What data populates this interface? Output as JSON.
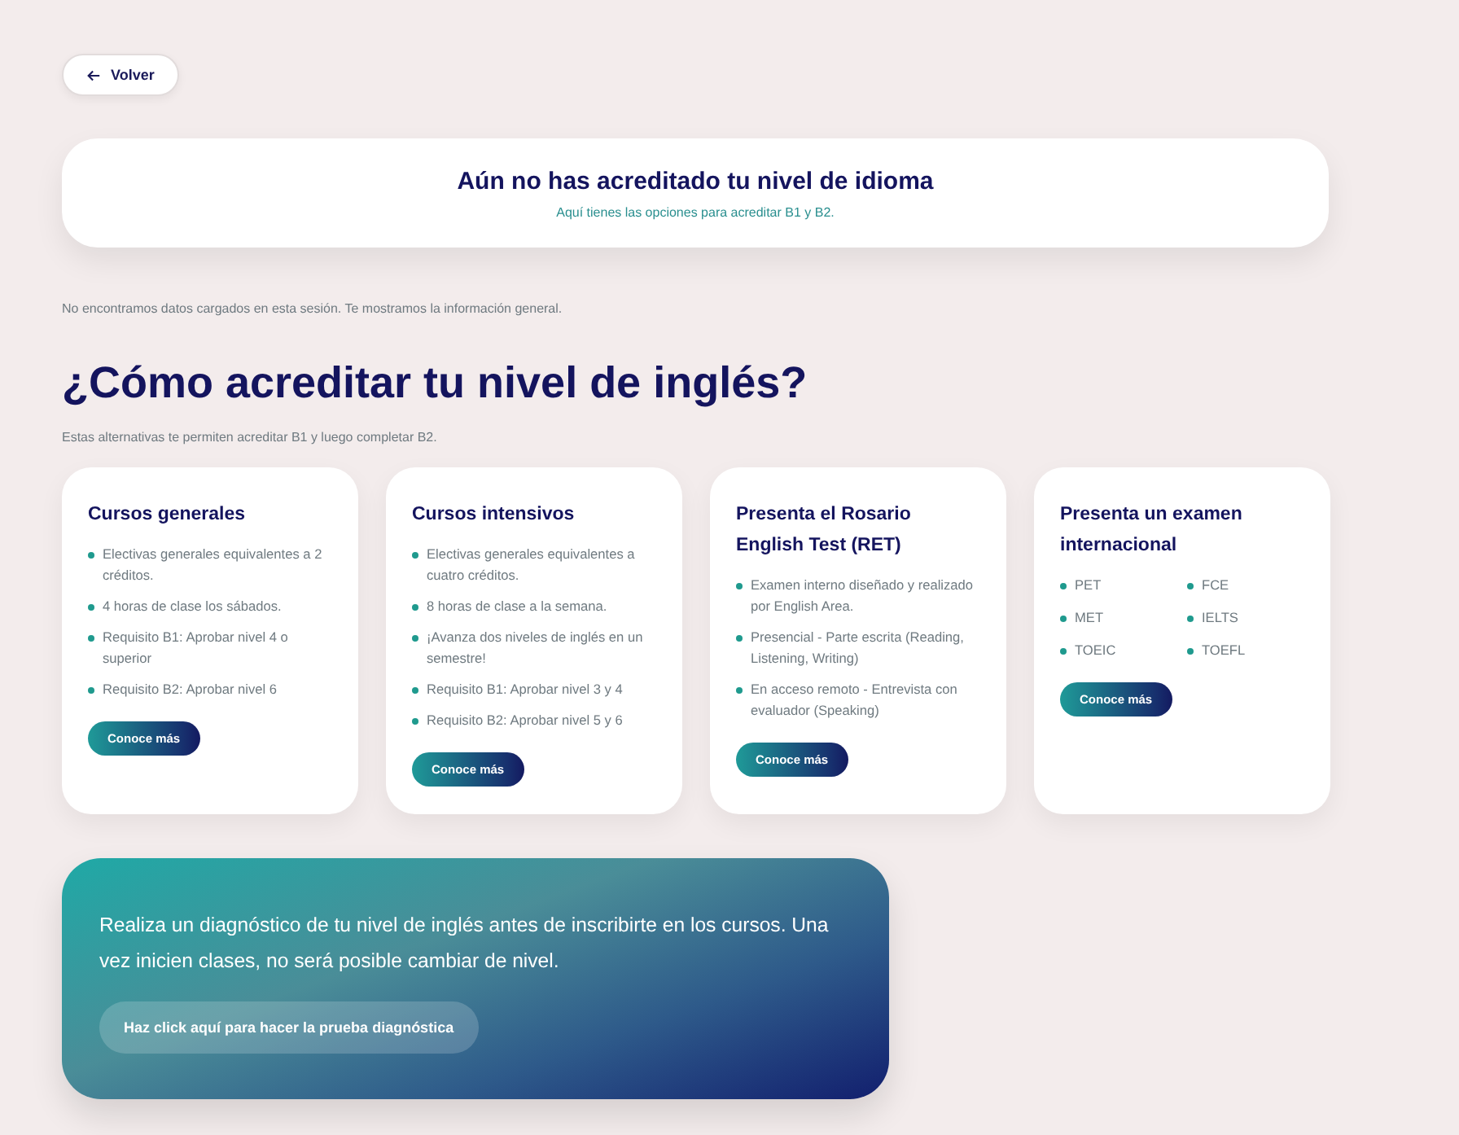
{
  "back_button": {
    "label": "Volver"
  },
  "banner": {
    "title": "Aún no has acreditado tu nivel de idioma",
    "subtitle": "Aquí tienes las opciones para acreditar B1 y B2."
  },
  "notice": "No encontramos datos cargados en esta sesión. Te mostramos la información general.",
  "heading": "¿Cómo acreditar tu nivel de inglés?",
  "subheading": "Estas alternativas te permiten acreditar B1 y luego completar B2.",
  "cards": [
    {
      "kind": "list",
      "title": "Cursos generales",
      "items": [
        "Electivas generales equivalentes a 2 créditos.",
        "4 horas de clase los sábados.",
        "Requisito B1: Aprobar nivel 4 o superior",
        "Requisito B2: Aprobar nivel 6"
      ],
      "button": "Conoce más"
    },
    {
      "kind": "list",
      "title": "Cursos intensivos",
      "items": [
        "Electivas generales equivalentes a cuatro créditos.",
        "8 horas de clase a la semana.",
        "¡Avanza dos niveles de inglés en un semestre!",
        "Requisito B1: Aprobar nivel 3 y 4",
        "Requisito B2: Aprobar nivel 5 y 6"
      ],
      "button": "Conoce más"
    },
    {
      "kind": "list",
      "title": "Presenta el Rosario English Test (RET)",
      "items": [
        "Examen interno diseñado y realizado por English Area.",
        "Presencial - Parte escrita (Reading, Listening, Writing)",
        "En acceso remoto - Entrevista con evaluador (Speaking)"
      ],
      "button": "Conoce más"
    },
    {
      "kind": "grid",
      "title": "Presenta un examen internacional",
      "items": [
        "PET",
        "FCE",
        "MET",
        "IELTS",
        "TOEIC",
        "TOEFL"
      ],
      "button": "Conoce más"
    }
  ],
  "diagnostic": {
    "text": "Realiza un diagnóstico de tu nivel de inglés antes de inscribirte en los cursos. Una vez inicien clases, no será posible cambiar de nivel.",
    "button": "Haz click aquí para hacer la prueba diagnóstica"
  }
}
